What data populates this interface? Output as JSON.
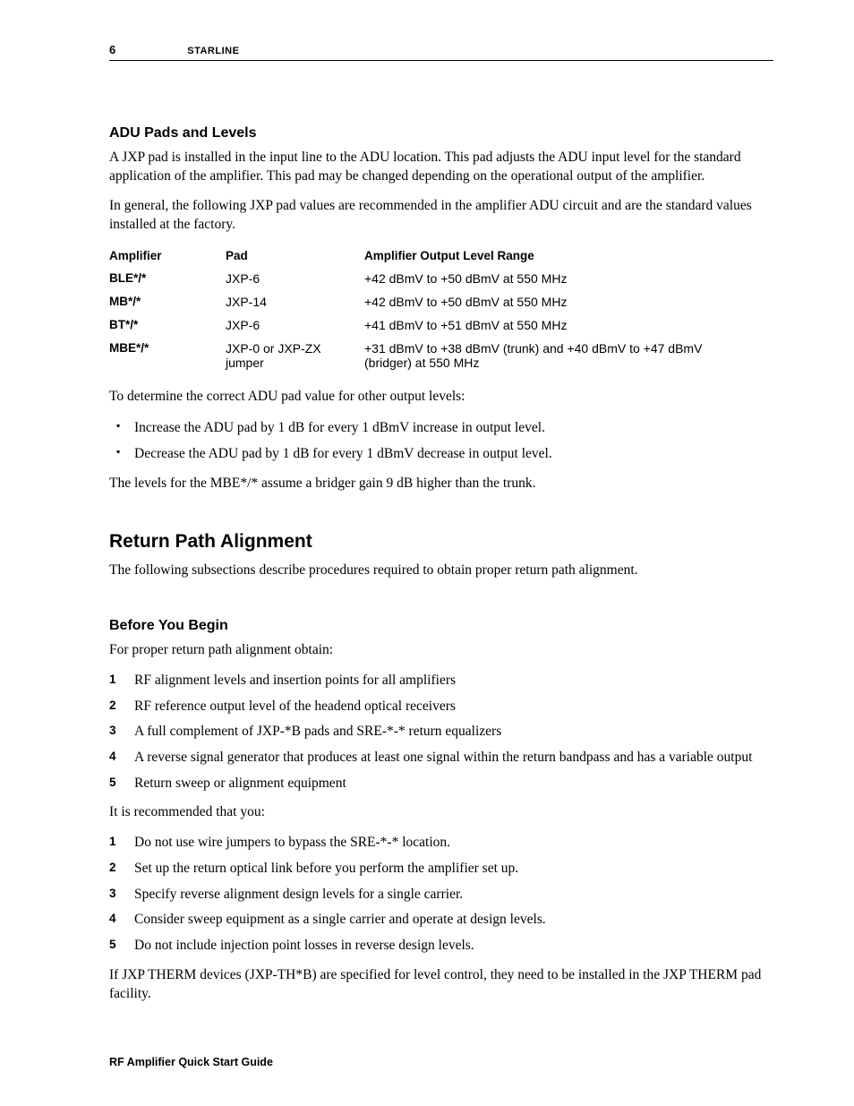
{
  "header": {
    "page_number": "6",
    "title": "STARLINE"
  },
  "s1": {
    "heading": "ADU Pads and Levels",
    "p1": "A JXP pad is installed in the input line to the ADU location. This pad adjusts the ADU input level for the standard application of the amplifier. This pad may be changed depending on the operational output of the amplifier.",
    "p2": "In general, the following JXP pad values are recommended in the amplifier ADU circuit and are the standard values installed at the factory.",
    "table": {
      "h1": "Amplifier",
      "h2": "Pad",
      "h3": "Amplifier Output Level Range",
      "rows": [
        {
          "amp": "BLE*/*",
          "pad": "JXP-6",
          "out": "+42 dBmV to +50 dBmV at 550 MHz"
        },
        {
          "amp": "MB*/*",
          "pad": "JXP-14",
          "out": "+42 dBmV to +50 dBmV at 550 MHz"
        },
        {
          "amp": "BT*/*",
          "pad": "JXP-6",
          "out": "+41 dBmV to +51 dBmV at 550 MHz"
        },
        {
          "amp": "MBE*/*",
          "pad": "JXP-0 or JXP-ZX jumper",
          "out": "+31 dBmV to +38 dBmV (trunk) and +40 dBmV to +47 dBmV (bridger) at 550 MHz"
        }
      ]
    },
    "p3": "To determine the correct ADU pad value for other output levels:",
    "bullets": [
      "Increase the ADU pad by 1 dB for every 1 dBmV increase in output level.",
      "Decrease the ADU pad by 1 dB for every 1 dBmV decrease in output level."
    ],
    "p4": "The levels for the MBE*/* assume a bridger gain 9 dB higher than the trunk."
  },
  "s2": {
    "heading": "Return Path Alignment",
    "p1": "The following subsections describe procedures required to obtain proper return path alignment."
  },
  "s3": {
    "heading": "Before You Begin",
    "p1": "For proper return path alignment obtain:",
    "list1": [
      "RF alignment levels and insertion points for all amplifiers",
      "RF reference output level of the headend optical receivers",
      "A full complement of JXP-*B pads and SRE-*-* return equalizers",
      "A reverse signal generator that produces at least one signal within the return bandpass and has a variable output",
      "Return sweep or alignment equipment"
    ],
    "p2": "It is recommended that you:",
    "list2": [
      "Do not use wire jumpers to bypass the SRE-*-* location.",
      "Set up the return optical link before you perform the amplifier set up.",
      "Specify reverse alignment design levels for a single carrier.",
      "Consider sweep equipment as a single carrier and operate at design levels.",
      "Do not include injection point losses in reverse design levels."
    ],
    "p3": "If JXP THERM devices (JXP-TH*B) are specified for level control, they need to be installed in the JXP THERM pad facility."
  },
  "footer": {
    "text": "RF Amplifier Quick Start Guide"
  }
}
